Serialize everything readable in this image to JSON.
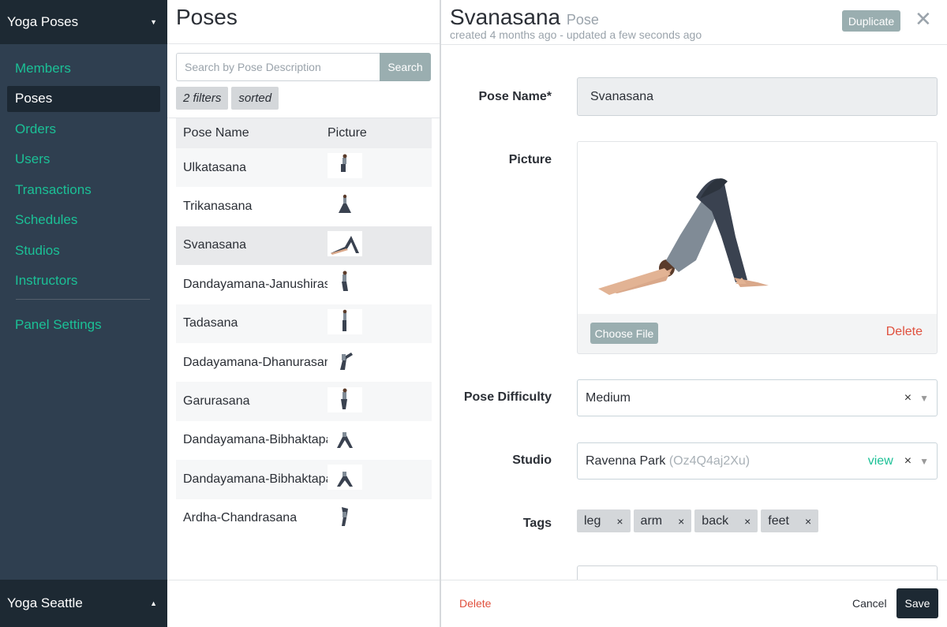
{
  "sidebar": {
    "app_title": "Yoga Poses",
    "items": [
      {
        "label": "Members"
      },
      {
        "label": "Poses"
      },
      {
        "label": "Orders"
      },
      {
        "label": "Users"
      },
      {
        "label": "Transactions"
      },
      {
        "label": "Schedules"
      },
      {
        "label": "Studios"
      },
      {
        "label": "Instructors"
      }
    ],
    "panel_settings": "Panel Settings",
    "account": "Yoga Seattle",
    "active_item": "Poses"
  },
  "list": {
    "title": "Poses",
    "search_placeholder": "Search by Pose Description",
    "search_button": "Search",
    "filters_chip": "2 filters",
    "sorted_chip": "sorted",
    "columns": [
      "Pose Name",
      "Picture"
    ],
    "rows": [
      {
        "name": "Ulkatasana"
      },
      {
        "name": "Trikanasana"
      },
      {
        "name": "Svanasana"
      },
      {
        "name": "Dandayamana-Janushirasana"
      },
      {
        "name": "Tadasana"
      },
      {
        "name": "Dadayamana-Dhanurasana"
      },
      {
        "name": "Garurasana"
      },
      {
        "name": "Dandayamana-Bibhaktapada"
      },
      {
        "name": "Dandayamana-Bibhaktapada"
      },
      {
        "name": "Ardha-Chandrasana"
      }
    ],
    "selected_row": "Svanasana"
  },
  "detail": {
    "title": "Svanasana",
    "subtitle": "Pose",
    "meta": "created 4 months ago - updated a few seconds ago",
    "duplicate_button": "Duplicate",
    "close_glyph": "✕",
    "fields": {
      "pose_name_label": "Pose Name*",
      "pose_name_value": "Svanasana",
      "picture_label": "Picture",
      "choose_file": "Choose File",
      "picture_delete": "Delete",
      "difficulty_label": "Pose Difficulty",
      "difficulty_value": "Medium",
      "studio_label": "Studio",
      "studio_value": "Ravenna Park",
      "studio_id": "(Oz4Q4aj2Xu)",
      "studio_view": "view",
      "tags_label": "Tags",
      "clear_glyph": "×",
      "arrow_glyph": "▼",
      "tags": [
        {
          "label": "leg"
        },
        {
          "label": "arm"
        },
        {
          "label": "back"
        },
        {
          "label": "feet"
        }
      ]
    },
    "footer": {
      "delete": "Delete",
      "cancel": "Cancel",
      "save": "Save"
    }
  },
  "colors": {
    "accent_green": "#1bc096",
    "danger_red": "#e0503d",
    "sidebar_bg": "#2f3f50",
    "sidebar_dark": "#1d2933",
    "button_gray": "#9aaeb0",
    "yoga_top": "#808b96",
    "yoga_pants": "#3a4250"
  }
}
